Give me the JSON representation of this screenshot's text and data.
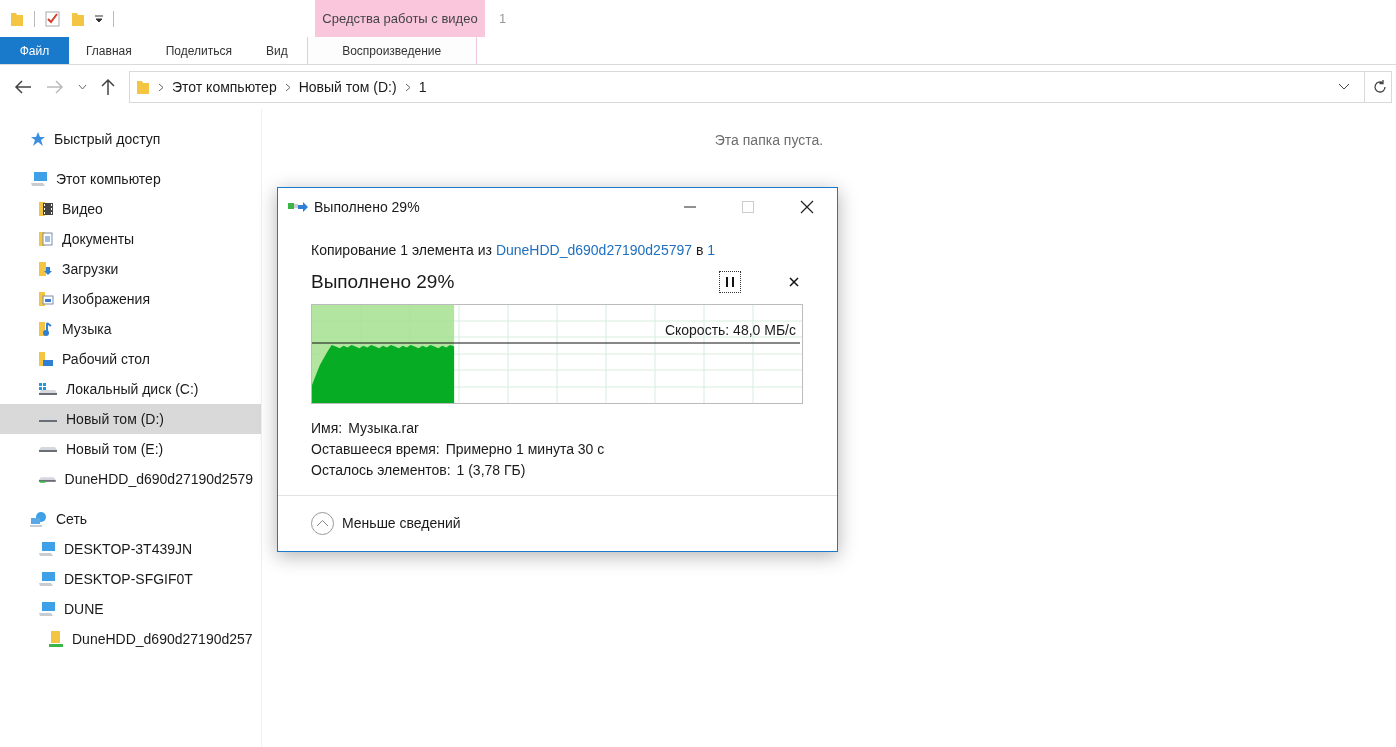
{
  "ribbon": {
    "context_group": "Средства работы с видео",
    "window_title": "1",
    "tabs": [
      {
        "label": "Файл",
        "kind": "file",
        "selected": false
      },
      {
        "label": "Главная",
        "kind": "tab",
        "selected": false
      },
      {
        "label": "Поделиться",
        "kind": "tab",
        "selected": false
      },
      {
        "label": "Вид",
        "kind": "tab",
        "selected": false
      },
      {
        "label": "Воспроизведение",
        "kind": "context",
        "selected": false
      }
    ]
  },
  "address_bar": {
    "path": [
      "Этот компьютер",
      "Новый том (D:)",
      "1"
    ]
  },
  "sidebar": {
    "items": [
      {
        "label": "Быстрый доступ",
        "kind": "star",
        "selected": false
      },
      {
        "label": "Этот компьютер",
        "kind": "computer",
        "selected": false,
        "children": [
          {
            "label": "Видео",
            "kind": "video",
            "selected": false
          },
          {
            "label": "Документы",
            "kind": "docs",
            "selected": false
          },
          {
            "label": "Загрузки",
            "kind": "downloads",
            "selected": false
          },
          {
            "label": "Изображения",
            "kind": "pictures",
            "selected": false
          },
          {
            "label": "Музыка",
            "kind": "music",
            "selected": false
          },
          {
            "label": "Рабочий стол",
            "kind": "desktop",
            "selected": false
          },
          {
            "label": "Локальный диск (C:)",
            "kind": "system-drive",
            "selected": false
          },
          {
            "label": "Новый том (D:)",
            "kind": "drive",
            "selected": true
          },
          {
            "label": "Новый том (E:)",
            "kind": "drive",
            "selected": false
          },
          {
            "label": "DuneHDD_d690d27190d2579",
            "kind": "net-drive",
            "selected": false
          }
        ]
      },
      {
        "label": "Сеть",
        "kind": "network",
        "selected": false,
        "children": [
          {
            "label": "DESKTOP-3T439JN",
            "kind": "computer",
            "selected": false
          },
          {
            "label": "DESKTOP-SFGIF0T",
            "kind": "computer",
            "selected": false
          },
          {
            "label": "DUNE",
            "kind": "computer",
            "selected": false,
            "children": [
              {
                "label": "DuneHDD_d690d27190d257",
                "kind": "net-folder",
                "selected": false
              }
            ]
          }
        ]
      }
    ]
  },
  "content": {
    "empty_message": "Эта папка пуста."
  },
  "dialog": {
    "title": "Выполнено 29%",
    "copy_text": "Копирование 1 элемента из ",
    "source": "DuneHDD_d690d27190d25797",
    "copy_to": " в ",
    "destination": "1",
    "heading": "Выполнено 29%",
    "progress": {
      "level": 0.29
    },
    "speed": "Скорость: 48,0 МБ/с",
    "details": [
      {
        "label": "Имя:",
        "value": "Музыка.rar"
      },
      {
        "label": "Оставшееся время:",
        "value": "Примерно 1 минута 30 с"
      },
      {
        "label": "Осталось элементов:",
        "value": "1 (3,78 ГБ)"
      }
    ],
    "toggle": "Меньше сведений"
  }
}
